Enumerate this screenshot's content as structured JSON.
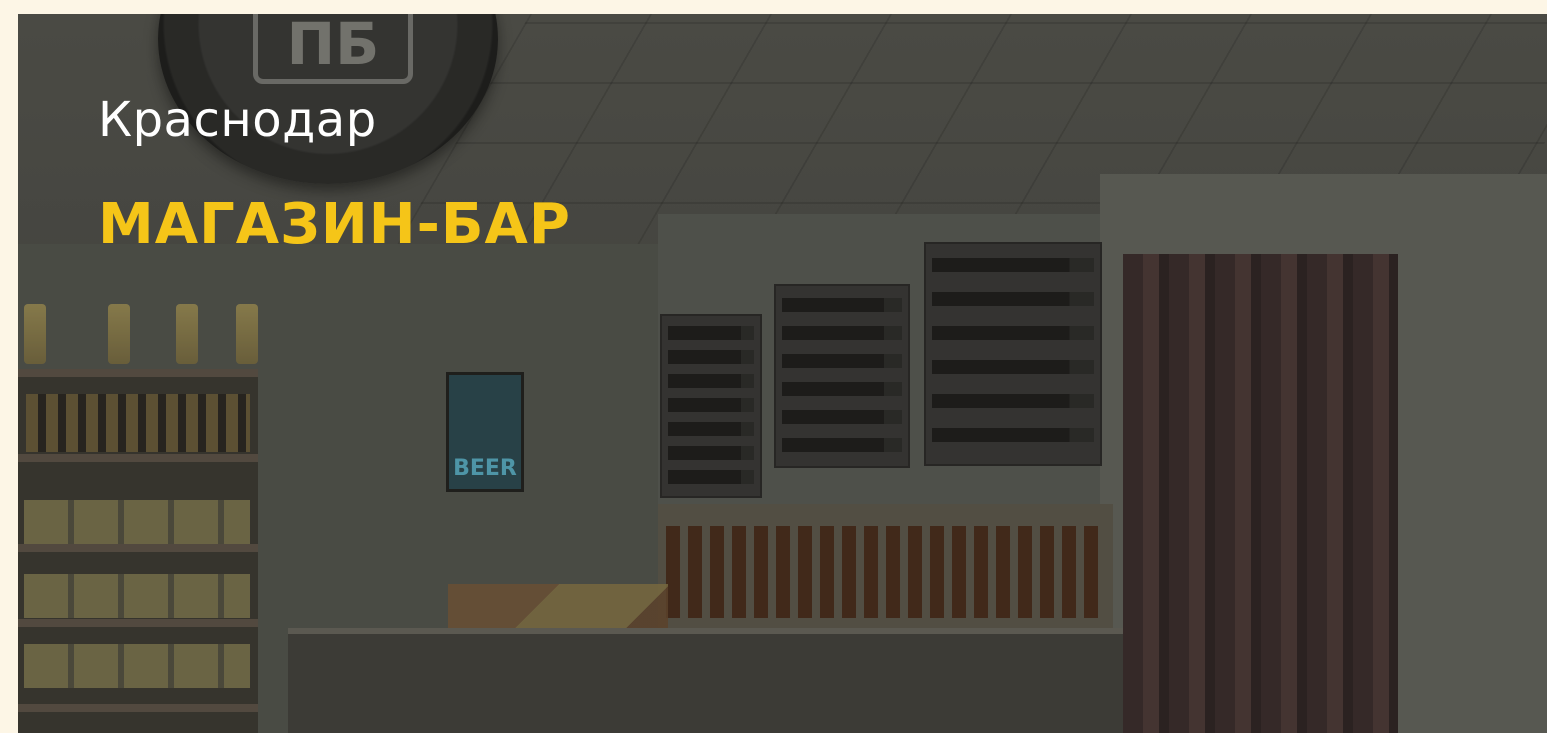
{
  "hero": {
    "city": "Краснодар",
    "title": "МАГАЗИН-БАР"
  },
  "background": {
    "poster_text": "BEER"
  },
  "colors": {
    "page_background": "#fdf6e6",
    "title_accent": "#f5c518",
    "city_text": "#ffffff"
  }
}
